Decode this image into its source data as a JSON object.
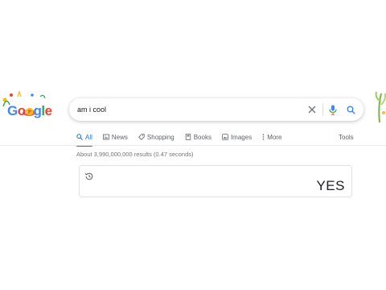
{
  "logo": {
    "letters": [
      "G",
      "o",
      "o",
      "g",
      "l",
      "e"
    ]
  },
  "search": {
    "query": "am i cool"
  },
  "tabs": [
    {
      "label": "All",
      "icon": "search-icon",
      "active": true
    },
    {
      "label": "News",
      "icon": "news-icon",
      "active": false
    },
    {
      "label": "Shopping",
      "icon": "tag-icon",
      "active": false
    },
    {
      "label": "Books",
      "icon": "book-icon",
      "active": false
    },
    {
      "label": "Images",
      "icon": "image-icon",
      "active": false
    },
    {
      "label": "More",
      "icon": "more-vert-icon",
      "active": false
    }
  ],
  "tools_label": "Tools",
  "result_stats": "About 3,990,000,000 results (0.47 seconds)",
  "answer_card": {
    "text": "YES",
    "icon": "history-icon"
  },
  "colors": {
    "accent": "#1a73e8",
    "text": "#202124",
    "muted": "#5f6368"
  }
}
